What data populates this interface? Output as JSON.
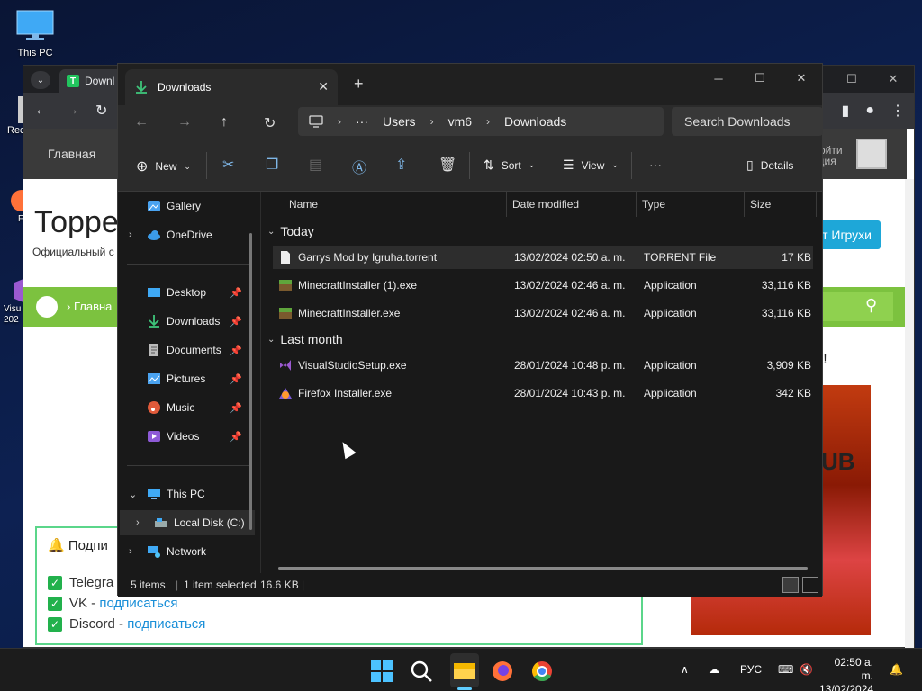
{
  "desktop": {
    "icons": [
      {
        "label": "This PC"
      },
      {
        "label": "Rec"
      },
      {
        "label": "F"
      },
      {
        "label": "Visu"
      },
      {
        "label": "202"
      }
    ]
  },
  "browser": {
    "tab_label": "Downl",
    "tab_favicon": "T",
    "site": {
      "home_link": "Главная",
      "login_text": "Войти",
      "login_text2": "ация",
      "title": "Торре",
      "subtitle": "Официальный с",
      "games_button": "т Игрухи",
      "breadcrumb": "Главна",
      "side_text": "а!",
      "side_image_text": "UB",
      "subscribe": {
        "title": "Подпи",
        "items": [
          {
            "name": "Telegra",
            "link": ""
          },
          {
            "name": "VK - ",
            "link": "подписаться"
          },
          {
            "name": "Discord - ",
            "link": "подписаться"
          }
        ]
      }
    }
  },
  "explorer": {
    "tab_title": "Downloads",
    "address": {
      "crumbs": [
        "Users",
        "vm6",
        "Downloads"
      ],
      "ellipsis": "···"
    },
    "search_placeholder": "Search Downloads",
    "commands": {
      "new": "New",
      "sort": "Sort",
      "view": "View",
      "more": "···",
      "details": "Details"
    },
    "nav": {
      "gallery": "Gallery",
      "onedrive": "OneDrive",
      "desktop": "Desktop",
      "downloads": "Downloads",
      "documents": "Documents",
      "pictures": "Pictures",
      "music": "Music",
      "videos": "Videos",
      "this_pc": "This PC",
      "local_disk": "Local Disk (C:)",
      "network": "Network"
    },
    "columns": {
      "name": "Name",
      "date": "Date modified",
      "type": "Type",
      "size": "Size"
    },
    "groups": [
      {
        "label": "Today",
        "files": [
          {
            "name": "Garrys Mod by Igruha.torrent",
            "date": "13/02/2024 02:50 a. m.",
            "type": "TORRENT File",
            "size": "17 KB",
            "icon": "document-icon",
            "selected": true
          },
          {
            "name": "MinecraftInstaller (1).exe",
            "date": "13/02/2024 02:46 a. m.",
            "type": "Application",
            "size": "33,116 KB",
            "icon": "minecraft-icon",
            "selected": false
          },
          {
            "name": "MinecraftInstaller.exe",
            "date": "13/02/2024 02:46 a. m.",
            "type": "Application",
            "size": "33,116 KB",
            "icon": "minecraft-icon",
            "selected": false
          }
        ]
      },
      {
        "label": "Last month",
        "files": [
          {
            "name": "VisualStudioSetup.exe",
            "date": "28/01/2024 10:48 p. m.",
            "type": "Application",
            "size": "3,909 KB",
            "icon": "visual-studio-icon",
            "selected": false
          },
          {
            "name": "Firefox Installer.exe",
            "date": "28/01/2024 10:43 p. m.",
            "type": "Application",
            "size": "342 KB",
            "icon": "firefox-installer-icon",
            "selected": false
          }
        ]
      }
    ],
    "status": {
      "items": "5 items",
      "selected": "1 item selected",
      "size": "16.6 KB"
    }
  },
  "taskbar": {
    "lang": "РУС",
    "time": "02:50 a. m.",
    "date": "13/02/2024"
  }
}
